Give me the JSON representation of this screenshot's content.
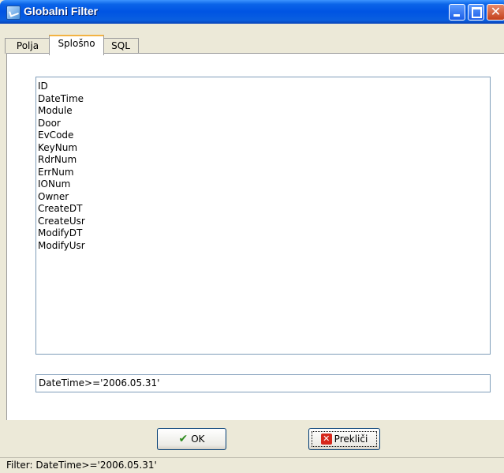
{
  "window": {
    "title": "Globalni Filter"
  },
  "tabs": [
    {
      "label": "Polja"
    },
    {
      "label": "Splošno"
    },
    {
      "label": "SQL"
    }
  ],
  "fields": [
    "ID",
    "DateTime",
    "Module",
    "Door",
    "EvCode",
    "KeyNum",
    "RdrNum",
    "ErrNum",
    "IONum",
    "Owner",
    "CreateDT",
    "CreateUsr",
    "ModifyDT",
    "ModifyUsr"
  ],
  "filter_expression": "DateTime>='2006.05.31'",
  "buttons": {
    "ok_label": "OK",
    "cancel_label": "Prekliči"
  },
  "status": {
    "text": "Filter: DateTime>='2006.05.31'"
  },
  "icons": {
    "ok": "checkmark-icon",
    "cancel": "red-x-icon",
    "close": "close-icon",
    "minimize": "minimize-icon",
    "maximize": "maximize-icon"
  },
  "colors": {
    "titlebar": "#0054e3",
    "active_tab_accent": "#f3b343",
    "ok_check": "#2e8b1e",
    "cancel_x": "#d6281c"
  }
}
